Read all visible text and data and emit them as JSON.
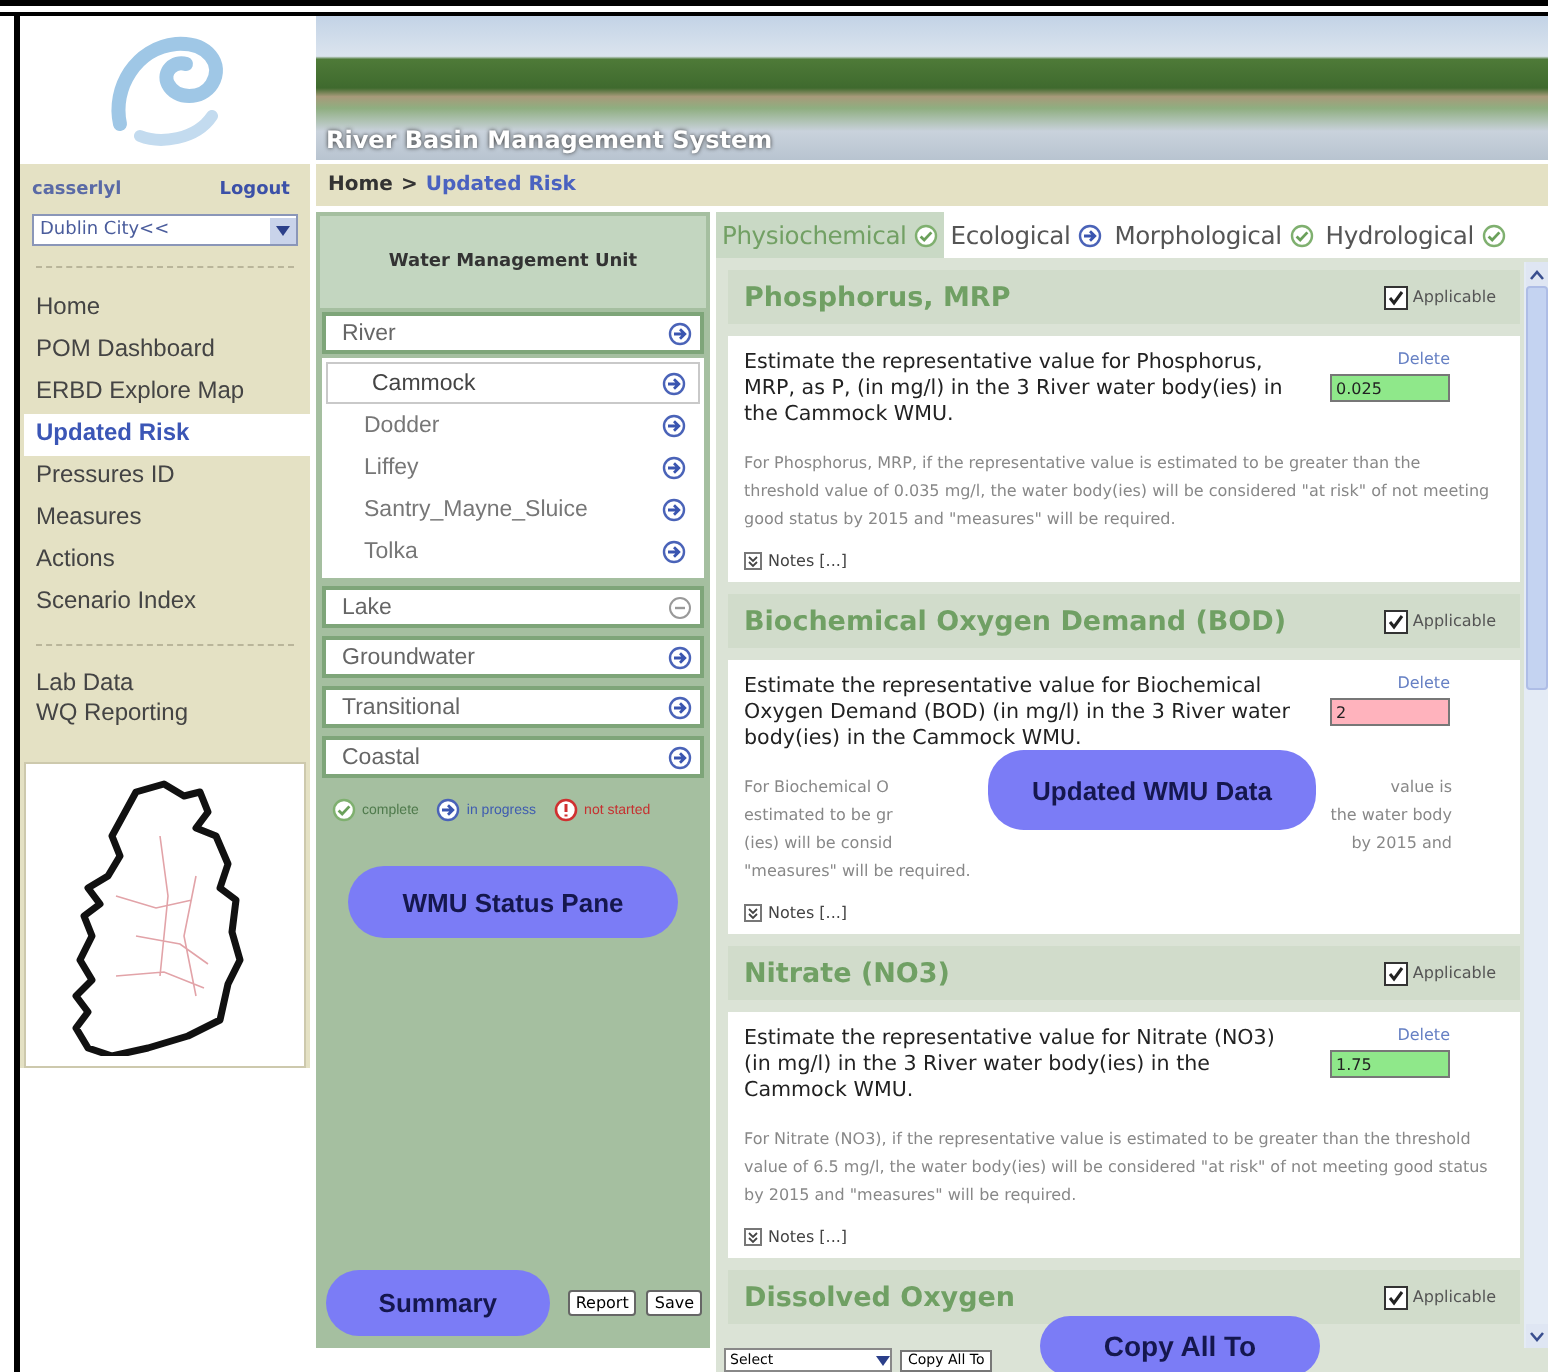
{
  "header": {
    "title": "River Basin Management System"
  },
  "user": {
    "name": "casserlyl",
    "logout": "Logout"
  },
  "region_select": {
    "value": "Dublin City<<"
  },
  "nav": {
    "items": [
      {
        "label": "Home",
        "selected": false
      },
      {
        "label": "POM Dashboard",
        "selected": false
      },
      {
        "label": "ERBD Explore Map",
        "selected": false
      },
      {
        "label": "Updated Risk",
        "selected": true
      },
      {
        "label": "Pressures ID",
        "selected": false
      },
      {
        "label": "Measures",
        "selected": false
      },
      {
        "label": "Actions",
        "selected": false
      },
      {
        "label": "Scenario Index",
        "selected": false
      }
    ],
    "secondary": [
      {
        "label": "Lab Data",
        "selected": false
      },
      {
        "label": "WQ Reporting",
        "selected": false
      }
    ]
  },
  "breadcrumb": {
    "items": [
      "Home",
      "Updated Risk"
    ],
    "separator": ">"
  },
  "wmu_pane": {
    "title": "Water Management Unit",
    "groups": [
      {
        "label": "River",
        "kind": "progress",
        "children": [
          {
            "label": "Cammock",
            "selected": true,
            "kind": "progress"
          },
          {
            "label": "Dodder",
            "selected": false,
            "kind": "progress"
          },
          {
            "label": "Liffey",
            "selected": false,
            "kind": "progress"
          },
          {
            "label": "Santry_Mayne_Sluice",
            "selected": false,
            "kind": "progress"
          },
          {
            "label": "Tolka",
            "selected": false,
            "kind": "progress"
          }
        ]
      },
      {
        "label": "Lake",
        "kind": "excluded"
      },
      {
        "label": "Groundwater",
        "kind": "progress"
      },
      {
        "label": "Transitional",
        "kind": "progress"
      },
      {
        "label": "Coastal",
        "kind": "progress"
      }
    ],
    "legend": [
      {
        "label": "complete",
        "kind": "complete"
      },
      {
        "label": "in progress",
        "kind": "progress"
      },
      {
        "label": "not started",
        "kind": "unstarted"
      }
    ],
    "status_callout": "WMU Status Pane",
    "summary_callout": "Summary",
    "buttons": [
      "Report",
      "Save"
    ]
  },
  "tabs": [
    {
      "label": "Physiochemical",
      "selected": true,
      "kind": "complete"
    },
    {
      "label": "Ecological",
      "selected": false,
      "kind": "progress"
    },
    {
      "label": "Morphological",
      "selected": false,
      "kind": "complete"
    },
    {
      "label": "Hydrological",
      "selected": false,
      "kind": "complete"
    }
  ],
  "parameters": [
    {
      "title": "Phosphorus, MRP",
      "applicable": true,
      "applicable_label": "Applicable",
      "question": "Estimate the representative value for Phosphorus, MRP, as P, (in mg/l) in the 3 River water body(ies) in the Cammock WMU.",
      "delete": "Delete",
      "value": "0.025",
      "exceeds": false,
      "note": "For Phosphorus, MRP, if the representative value is estimated to be greater than the threshold value of 0.035 mg/l, the water body(ies) will be considered \"at risk\" of not meeting good status by 2015 and \"measures\" will be required.",
      "notes_label": "Notes [...]"
    },
    {
      "title": "Biochemical Oxygen Demand (BOD)",
      "applicable": true,
      "applicable_label": "Applicable",
      "question": "Estimate the representative value for Biochemical Oxygen Demand (BOD) (in mg/l) in the 3 River water body(ies) in the Cammock WMU.",
      "delete": "Delete",
      "value": "2",
      "exceeds": true,
      "note_lines": [
        [
          "For Biochemical O",
          "value is"
        ],
        [
          "estimated to be gr",
          "the water body"
        ],
        [
          "(ies) will be consid",
          "by 2015 and"
        ],
        [
          "\"measures\" will be required."
        ]
      ],
      "callout": "Updated WMU Data",
      "notes_label": "Notes [...]"
    },
    {
      "title": "Nitrate (NO3)",
      "applicable": true,
      "applicable_label": "Applicable",
      "question": "Estimate the representative value for Nitrate (NO3) (in mg/l) in the 3 River water body(ies) in the Cammock WMU.",
      "delete": "Delete",
      "value": "1.75",
      "exceeds": false,
      "note": "For Nitrate (NO3), if the representative value is estimated to be greater than the threshold value of 6.5 mg/l, the water body(ies) will be considered \"at risk\" of not meeting good status by 2015 and \"measures\" will be required.",
      "notes_label": "Notes [...]"
    },
    {
      "title": "Dissolved Oxygen",
      "applicable": true,
      "applicable_label": "Applicable"
    }
  ],
  "copy_bar": {
    "select": "Select",
    "button": "Copy All To",
    "callout": "Copy All To"
  }
}
